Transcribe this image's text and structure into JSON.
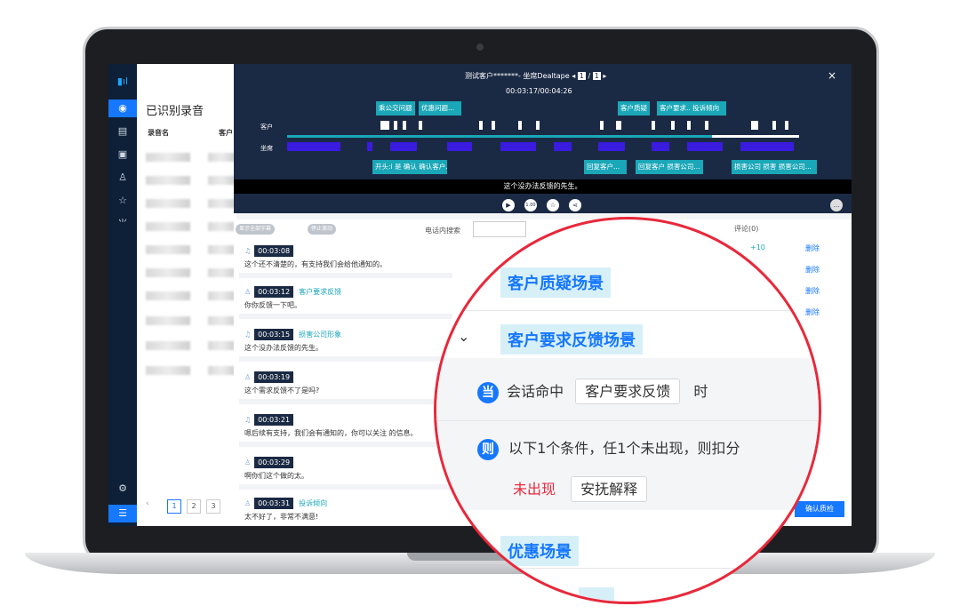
{
  "sidebar": {
    "logo": "logo-icon",
    "items": [
      "mic",
      "doc",
      "calendar",
      "users",
      "star",
      "chart",
      "gear",
      "list"
    ]
  },
  "list": {
    "title": "已识别录音",
    "header_name": "录音名",
    "header_customer": "客户",
    "pages": [
      "1",
      "2",
      "3"
    ]
  },
  "player": {
    "title": "测试客户*******- 坐席Dealtape",
    "page_cur": "1",
    "page_sep": "/",
    "page_total": "1",
    "time": "00:03:17/00:04:26",
    "row_customer": "客户",
    "row_agent": "坐席",
    "top_chips": [
      "乘公交问题",
      "优惠问题...",
      "客户质疑",
      "客户要求.. 投诉倾向"
    ],
    "bottom_chips": [
      "开头:i 是 确认 确认客户...",
      "回复客户...",
      "回复客户 损害公司...",
      "损害公司 损害 损害公司..."
    ],
    "subtitle": "这个没办法反馈的先生。",
    "speed": "1.00",
    "close": "×"
  },
  "toolbar": {
    "toggle1": "显示全部字幕",
    "toggle2": "停止滚动",
    "search_label": "电话内搜索",
    "comments": "评论(0)",
    "confirm": "确认质检"
  },
  "messages": [
    {
      "time": "00:03:08",
      "tag": "",
      "text": "这个还不清楚的，有支持我们会给他通知的。"
    },
    {
      "time": "00:03:12",
      "tag": "客户要求反馈",
      "text": "你你反馈一下吧。"
    },
    {
      "time": "00:03:15",
      "tag": "损害公司形象",
      "text": "这个没办法反馈的先生。"
    },
    {
      "time": "00:03:19",
      "tag": "",
      "text": "这个需求反馈不了是吗?"
    },
    {
      "time": "00:03:21",
      "tag": "",
      "text": "嗯后续有支持，我们会有通知的，你可以关注         的信息。"
    },
    {
      "time": "00:03:29",
      "tag": "",
      "text": "啊你们这个做的太。"
    },
    {
      "time": "00:03:31",
      "tag": "投诉倾向",
      "text": "太不好了，非常不满意!"
    }
  ],
  "score_col": {
    "plus": "+10",
    "plus2": "0",
    "del": "删除"
  },
  "zoom": {
    "scene1": "客户质疑场景",
    "scene2": "客户要求反馈场景",
    "when_icon": "当",
    "when_text": "会话命中",
    "when_box": "客户要求反馈",
    "when_suffix": "时",
    "then_icon": "则",
    "then_text": "以下1个条件，任1个未出现，则扣分",
    "absent": "未出现",
    "absent_box": "安抚解释",
    "scene3": "优惠场景"
  }
}
